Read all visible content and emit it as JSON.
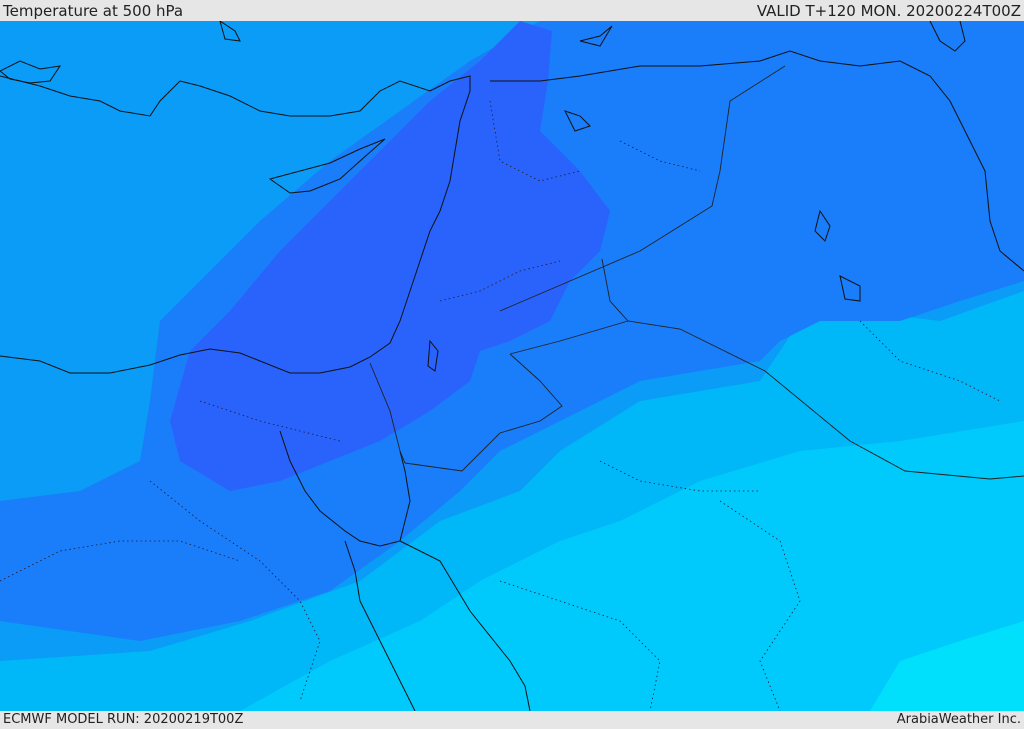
{
  "header": {
    "title": "Temperature at 500 hPa",
    "valid": "VALID T+120 MON. 20200224T00Z"
  },
  "footer": {
    "model_run": "ECMWF MODEL RUN: 20200219T00Z",
    "credit": "ArabiaWeather Inc."
  },
  "colors": {
    "band_base": "#0a9cf6",
    "band_cold_1": "#1a7df9",
    "band_cold_2": "#2a63fb",
    "band_warm_1": "#00b7f8",
    "band_warm_2": "#00c9fb",
    "band_warm_3": "#00e0fc",
    "coastline": "#111111",
    "borders": "#222222"
  }
}
